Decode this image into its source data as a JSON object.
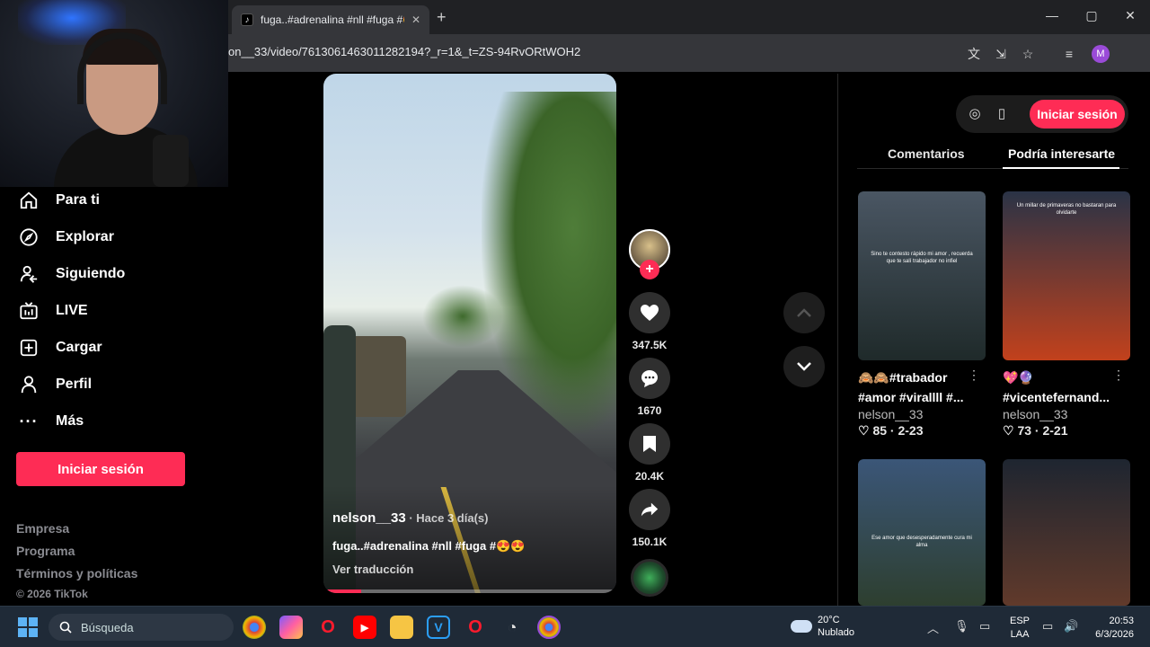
{
  "browser": {
    "tab_title": "fuga..#adrenalina #nll #fuga #😍",
    "tab_close": "✕",
    "new_tab": "+",
    "url": "on__33/video/7613061463011282194?_r=1&_t=ZS-94RvORtWOH2",
    "profile_initial": "M",
    "window_controls": {
      "minimize": "—",
      "maximize": "▢",
      "close": "✕"
    }
  },
  "sidebar": {
    "items": [
      {
        "label": "Para ti",
        "icon": "home-icon"
      },
      {
        "label": "Explorar",
        "icon": "compass-icon"
      },
      {
        "label": "Siguiendo",
        "icon": "following-icon"
      },
      {
        "label": "LIVE",
        "icon": "live-icon"
      },
      {
        "label": "Cargar",
        "icon": "upload-icon"
      },
      {
        "label": "Perfil",
        "icon": "profile-icon"
      },
      {
        "label": "Más",
        "icon": "more-icon"
      }
    ],
    "login": "Iniciar sesión",
    "footer": [
      "Empresa",
      "Programa",
      "Términos y políticas"
    ],
    "copyright": "© 2026 TikTok"
  },
  "video": {
    "author": "nelson__33",
    "time": " · Hace 3 día(s)",
    "caption": "fuga..#adrenalina #nll #fuga #😍😍",
    "translate": "Ver traducción",
    "progress": 0.13
  },
  "actions": {
    "likes": "347.5K",
    "comments": "1670",
    "saves": "20.4K",
    "shares": "150.1K",
    "follow": "+"
  },
  "right_panel": {
    "login": "Iniciar sesión",
    "tabs": [
      "Comentarios",
      "Podría interesarte"
    ],
    "active_tab": 1,
    "cards": [
      {
        "title1": "🙈🙈#trabador",
        "title2": "#amor #virallll #...",
        "author": "nelson__33",
        "stats": "♡ 85 · 2-23",
        "overlay": "Sino te contesto rápido mi amor , recuerda que te salí trabajador no infiel",
        "bg1": "#4a5663",
        "bg2": "#1f2a2a"
      },
      {
        "title1": "💖🔮",
        "title2": "#vicentefernand...",
        "author": "nelson__33",
        "stats": "♡ 73 · 2-21",
        "overlay": "Un millar de primaveras no bastaran para olvidarte",
        "bg1": "#2a3346",
        "bg2": "#c2411c"
      },
      {
        "title1": "",
        "title2": "",
        "author": "",
        "stats": "",
        "overlay": "Ese amor que desesperadamente cura mi alma",
        "bg1": "#3b5678",
        "bg2": "#2b3b24"
      },
      {
        "title1": "",
        "title2": "",
        "author": "",
        "stats": "",
        "overlay": "",
        "bg1": "#1e2530",
        "bg2": "#6b3d2a"
      }
    ]
  },
  "taskbar": {
    "search": "Búsqueda",
    "weather_temp": "20°C",
    "weather_desc": "Nublado",
    "lang1": "ESP",
    "lang2": "LAA",
    "time": "20:53",
    "date": "6/3/2026"
  },
  "colors": {
    "accent": "#fe2c55",
    "taskbar": "#1f2a37"
  }
}
